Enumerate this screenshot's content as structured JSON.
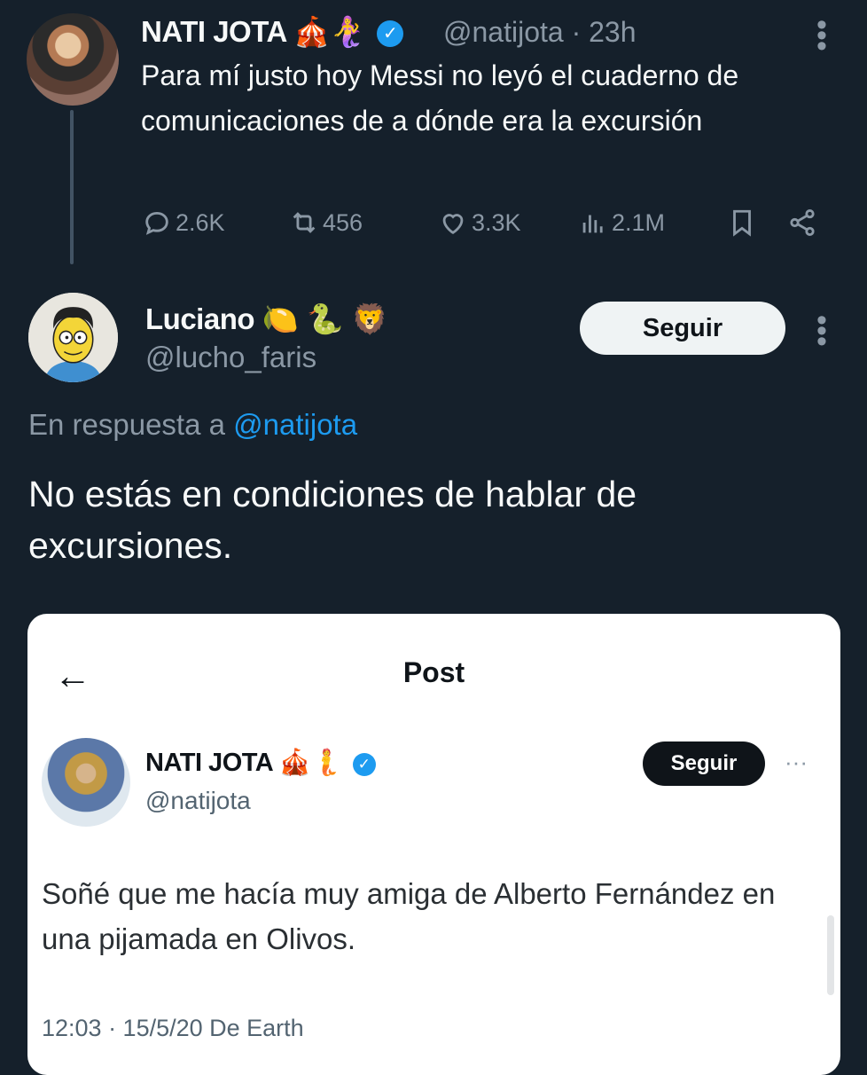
{
  "tweet1": {
    "name": "NATI JOTA",
    "emojis": "🎪🧜‍♀️",
    "verified": "✓",
    "handle": "@natijota",
    "time": "23h",
    "more": "⋮",
    "text": "Para mí justo hoy Messi no leyó el cuaderno de comunicaciones de a dónde era la excursión",
    "stats": {
      "replies": "2.6K",
      "retweets": "456",
      "likes": "3.3K",
      "views": "2.1M"
    }
  },
  "tweet2": {
    "name": "Luciano",
    "emojis": "🍋 🐍 🦁",
    "handle": "@lucho_faris",
    "follow_label": "Seguir",
    "more": "⋮",
    "reply_prefix": "En respuesta a",
    "reply_handle": "@natijota",
    "text": "No estás en condiciones de hablar de excursiones."
  },
  "embedded": {
    "back": "←",
    "title": "Post",
    "name": "NATI JOTA",
    "emojis": "🎪🧜",
    "verified": "✓",
    "handle": "@natijota",
    "follow_label": "Seguir",
    "more": "···",
    "text": "Soñé que me hacía muy amiga de Alberto Fernández en una pijamada en Olivos.",
    "meta": "12:03 · 15/5/20 De Earth"
  },
  "colors": {
    "background": "#15202b",
    "muted": "#8b98a5",
    "link": "#1d9bf0"
  }
}
